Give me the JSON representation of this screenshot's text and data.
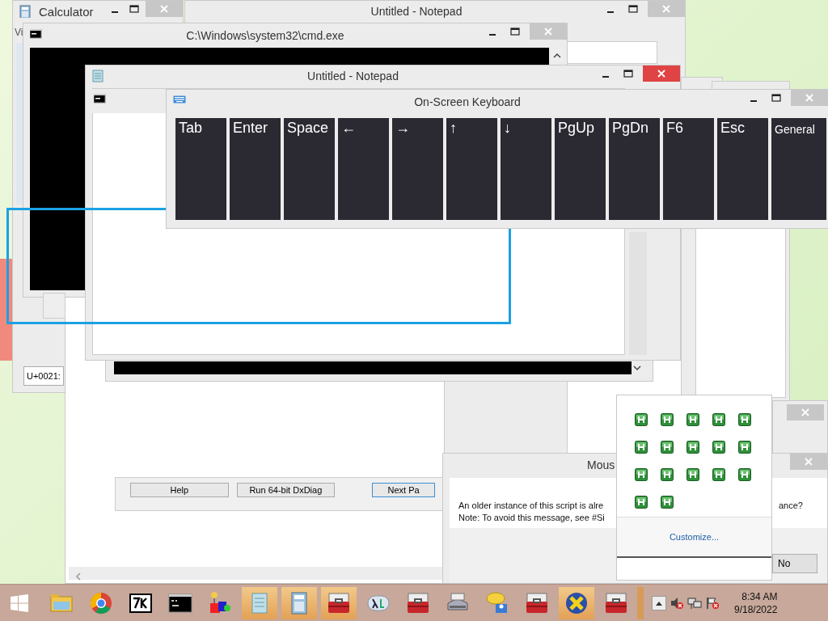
{
  "calculator": {
    "title": "Calculator",
    "menu": "Vi",
    "field": "U+0021:"
  },
  "notepad_back": {
    "title": "Untitled - Notepad"
  },
  "cmd_back": {
    "title": "C:\\Windows\\system32\\cmd.exe"
  },
  "dxdiag": {
    "buttons": [
      "Help",
      "Run 64-bit DxDiag",
      "Next Pa"
    ]
  },
  "notepad_front": {
    "title": "Untitled - Notepad",
    "close_highlighted": true
  },
  "keyboard": {
    "title": "On-Screen Keyboard",
    "keys": [
      "Tab",
      "Enter",
      "Space",
      "←",
      "→",
      "↑",
      "↓",
      "PgUp",
      "PgDn",
      "F6",
      "Esc",
      "General"
    ]
  },
  "mouse_dialog": {
    "title": "Mous",
    "message_left": "An older instance of this script is alre",
    "message_right": "ance?",
    "note": "Note: To avoid this message, see #Si",
    "buttons": [
      "No"
    ]
  },
  "tray_popup": {
    "icons": [
      {
        "kind": "h-app"
      },
      {
        "kind": "h-app"
      },
      {
        "kind": "h-app"
      },
      {
        "kind": "h-app"
      },
      {
        "kind": "h-app"
      },
      {
        "kind": "h-app"
      },
      {
        "kind": "h-app"
      },
      {
        "kind": "h-app"
      },
      {
        "kind": "h-app"
      },
      {
        "kind": "h-app"
      },
      {
        "kind": "h-app"
      },
      {
        "kind": "h-app"
      },
      {
        "kind": "h-app"
      },
      {
        "kind": "h-app"
      },
      {
        "kind": "h-app"
      },
      {
        "kind": "h-app"
      },
      {
        "kind": "h-app"
      }
    ],
    "link": "Customize..."
  },
  "taskbar": {
    "apps": [
      {
        "kind": "folder",
        "highlighted": false
      },
      {
        "kind": "browser",
        "highlighted": false
      },
      {
        "kind": "archive",
        "highlighted": false
      },
      {
        "kind": "terminal",
        "highlighted": false
      },
      {
        "kind": "shapes",
        "highlighted": false
      },
      {
        "kind": "notepad",
        "highlighted": true
      },
      {
        "kind": "calculator",
        "highlighted": true
      },
      {
        "kind": "toolbox",
        "highlighted": true
      },
      {
        "kind": "lambda",
        "highlighted": false
      },
      {
        "kind": "toolbox",
        "highlighted": false
      },
      {
        "kind": "scanner",
        "highlighted": false
      },
      {
        "kind": "chat",
        "highlighted": false
      },
      {
        "kind": "toolbox",
        "highlighted": false
      },
      {
        "kind": "xcircle",
        "highlighted": true
      },
      {
        "kind": "toolbox",
        "highlighted": false
      }
    ],
    "clock": {
      "time": "8:34 AM",
      "date": "9/18/2022"
    }
  }
}
